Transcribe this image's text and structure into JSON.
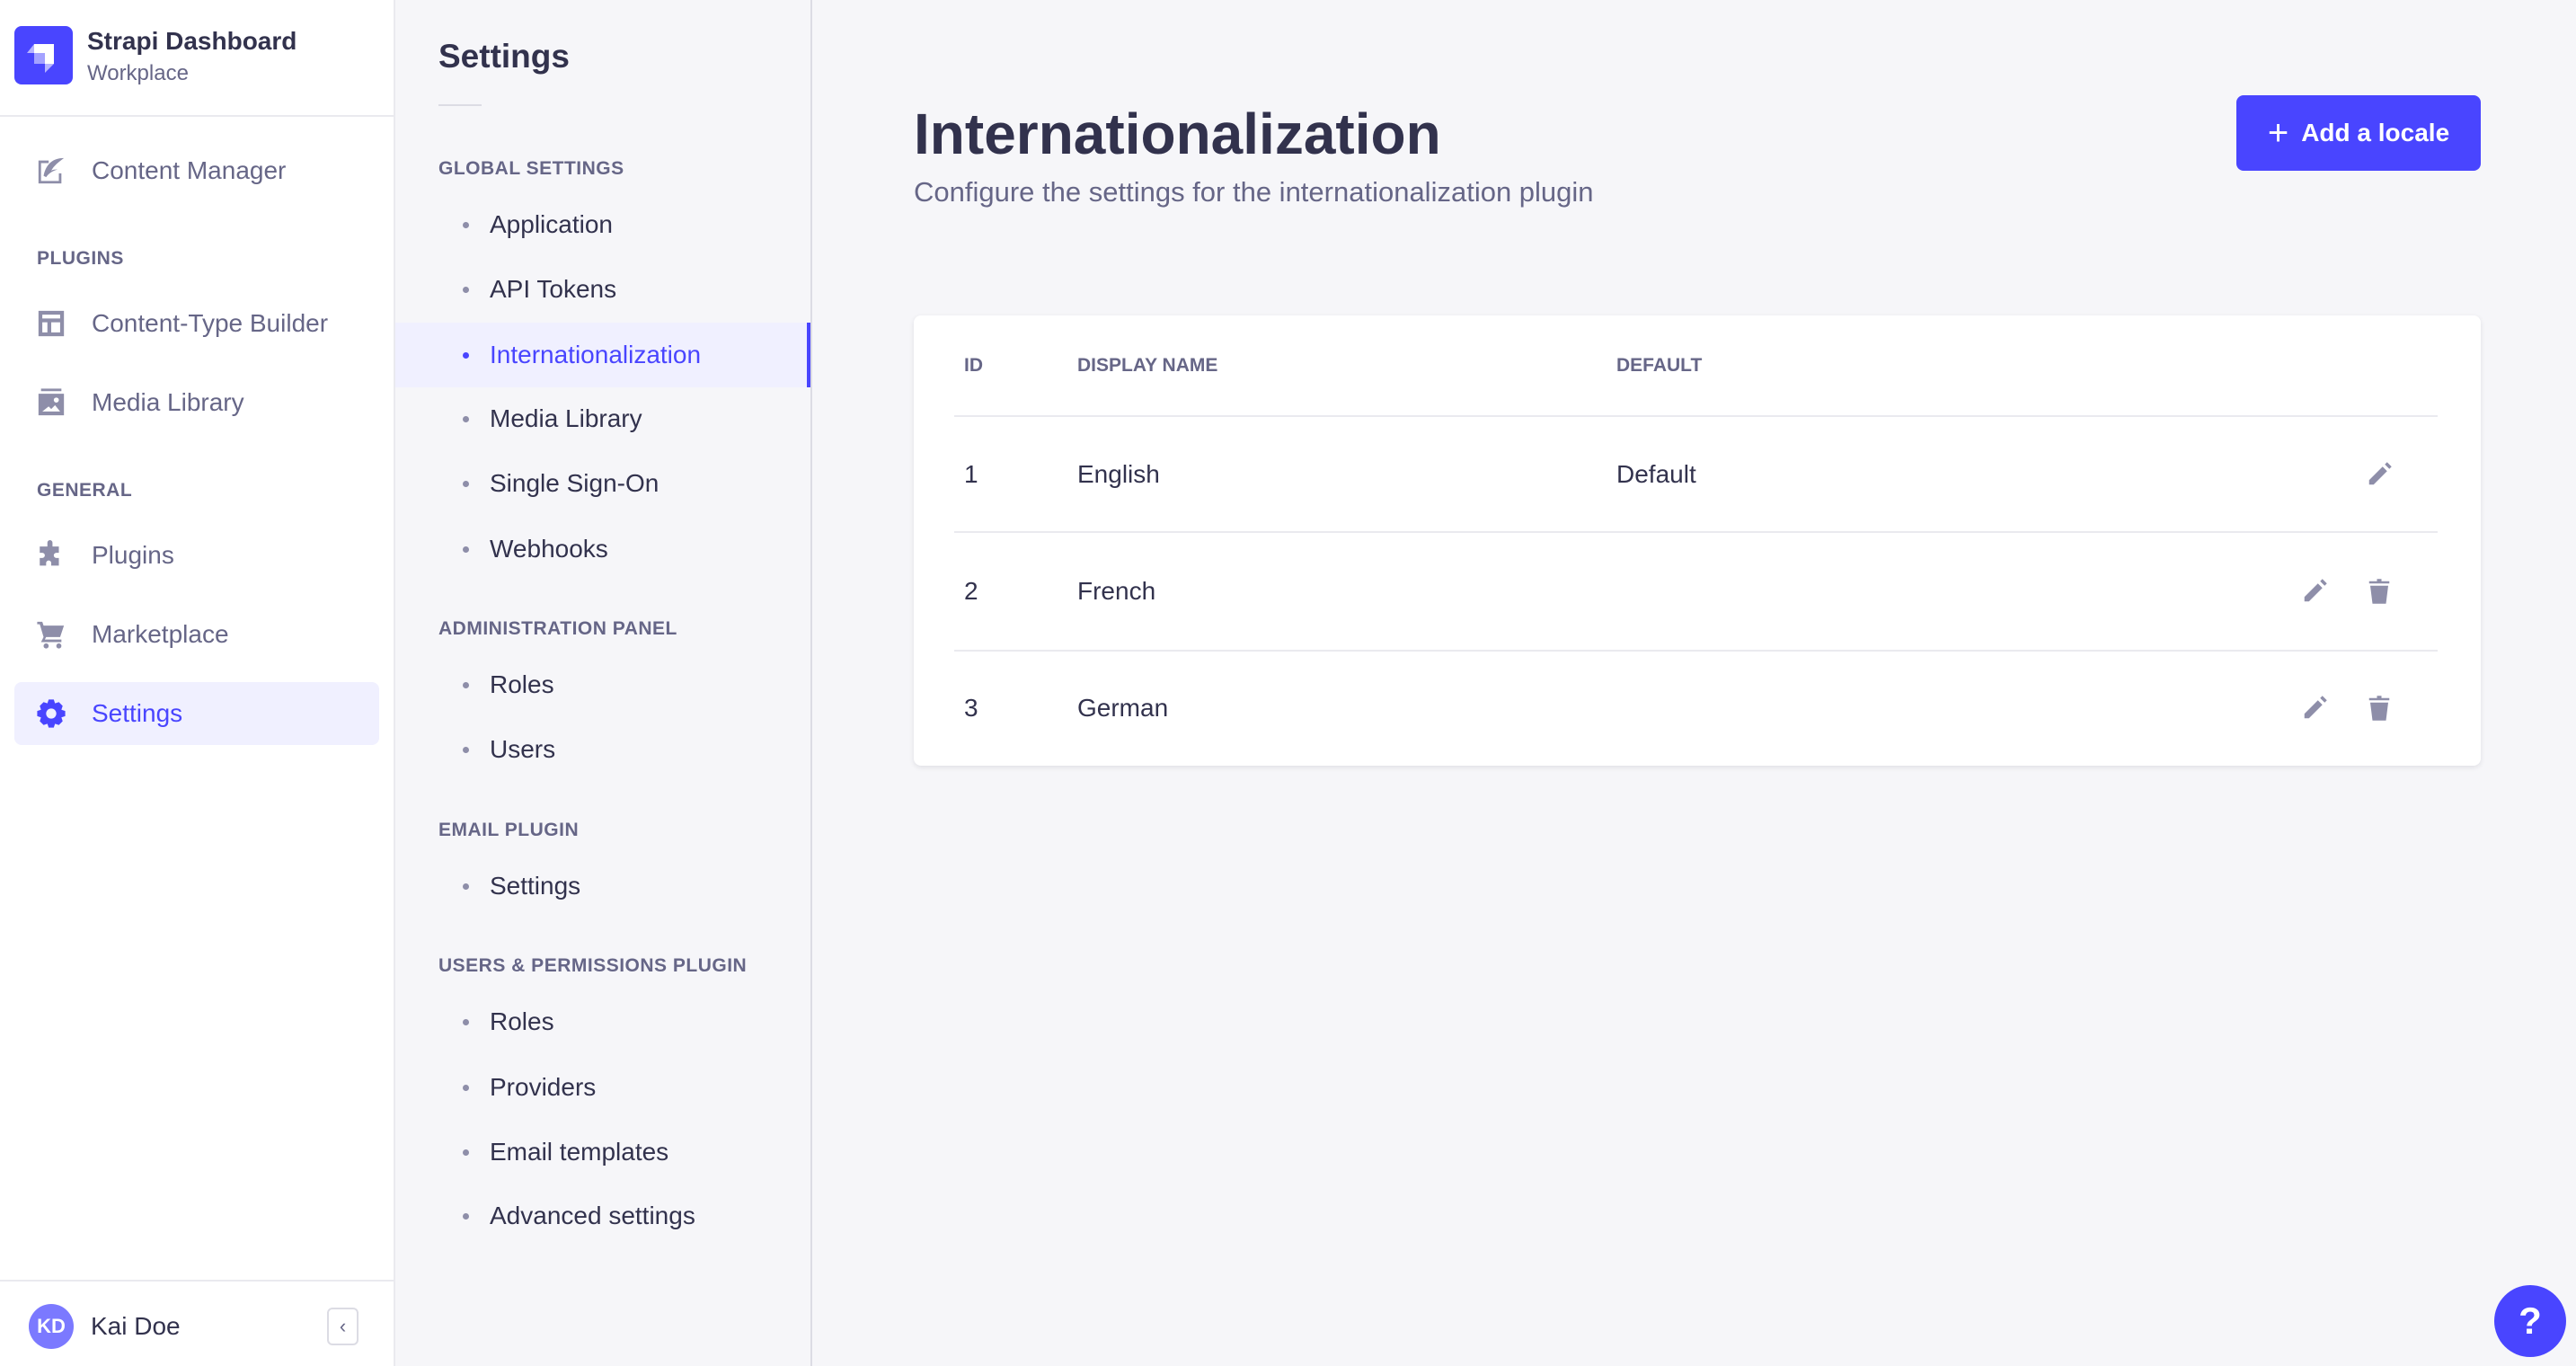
{
  "brand": {
    "title": "Strapi Dashboard",
    "workspace": "Workplace"
  },
  "nav": {
    "content_manager": "Content Manager",
    "plugins_heading": "PLUGINS",
    "content_type_builder": "Content-Type Builder",
    "media_library": "Media Library",
    "general_heading": "GENERAL",
    "plugins": "Plugins",
    "marketplace": "Marketplace",
    "settings": "Settings"
  },
  "user": {
    "initials": "KD",
    "name": "Kai Doe"
  },
  "settings_nav": {
    "title": "Settings",
    "sections": [
      {
        "heading": "GLOBAL SETTINGS",
        "items": [
          "Application",
          "API Tokens",
          "Internationalization",
          "Media Library",
          "Single Sign-On",
          "Webhooks"
        ]
      },
      {
        "heading": "ADMINISTRATION PANEL",
        "items": [
          "Roles",
          "Users"
        ]
      },
      {
        "heading": "EMAIL PLUGIN",
        "items": [
          "Settings"
        ]
      },
      {
        "heading": "USERS & PERMISSIONS PLUGIN",
        "items": [
          "Roles",
          "Providers",
          "Email templates",
          "Advanced settings"
        ]
      }
    ],
    "active": "Internationalization"
  },
  "page": {
    "title": "Internationalization",
    "subtitle": "Configure the settings for the internationalization plugin",
    "add_button": "Add a locale",
    "add_icon": "+"
  },
  "table": {
    "columns": [
      "ID",
      "DISPLAY NAME",
      "DEFAULT"
    ],
    "rows": [
      {
        "id": "1",
        "name": "English",
        "default": "Default"
      },
      {
        "id": "2",
        "name": "French",
        "default": ""
      },
      {
        "id": "3",
        "name": "German",
        "default": ""
      }
    ]
  },
  "help": {
    "label": "?"
  },
  "colors": {
    "primary": "#4945ff",
    "text": "#32324d",
    "muted": "#666687",
    "icon": "#8e8ea9"
  }
}
